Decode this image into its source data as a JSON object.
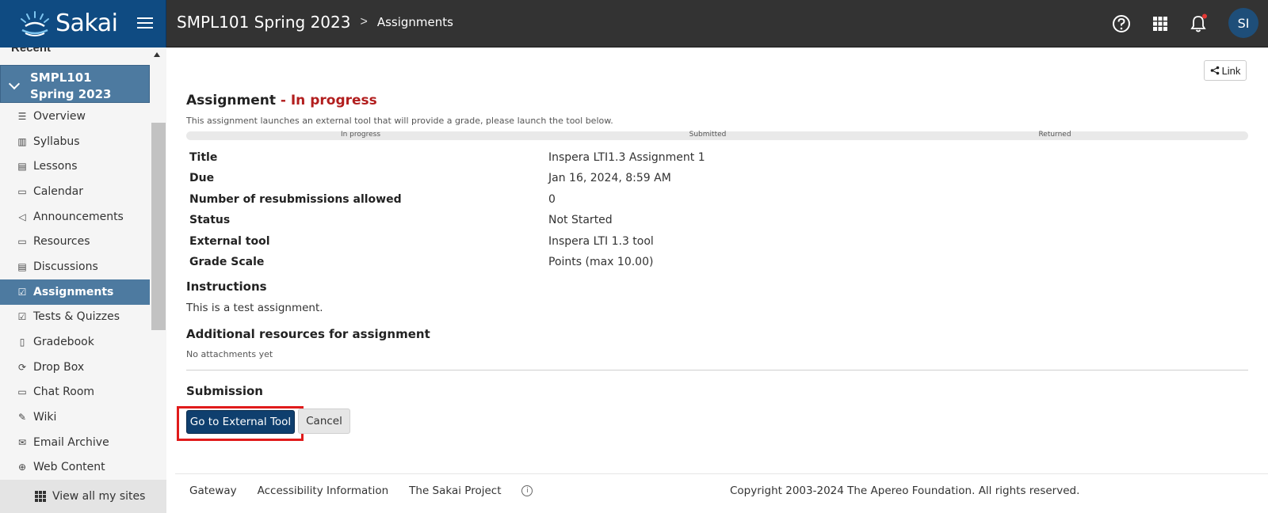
{
  "header": {
    "logo_text": "Sakai",
    "site_title": "SMPL101 Spring 2023",
    "breadcrumb_sep": ">",
    "tool_title": "Assignments",
    "avatar_initials": "SI"
  },
  "sidebar": {
    "recent_label": "Recent",
    "site_line1": "SMPL101",
    "site_line2": "Spring 2023",
    "items": [
      {
        "label": "Overview",
        "icon": "list-icon",
        "glyph": "☰"
      },
      {
        "label": "Syllabus",
        "icon": "map-icon",
        "glyph": "▥"
      },
      {
        "label": "Lessons",
        "icon": "document-icon",
        "glyph": "▤"
      },
      {
        "label": "Calendar",
        "icon": "calendar-icon",
        "glyph": "▭"
      },
      {
        "label": "Announcements",
        "icon": "megaphone-icon",
        "glyph": "◁"
      },
      {
        "label": "Resources",
        "icon": "folder-icon",
        "glyph": "▭"
      },
      {
        "label": "Discussions",
        "icon": "chat-icon",
        "glyph": "▤"
      },
      {
        "label": "Assignments",
        "icon": "assignment-icon",
        "glyph": "☑"
      },
      {
        "label": "Tests & Quizzes",
        "icon": "checkbox-icon",
        "glyph": "☑"
      },
      {
        "label": "Gradebook",
        "icon": "book-icon",
        "glyph": "▯"
      },
      {
        "label": "Drop Box",
        "icon": "sync-icon",
        "glyph": "⟳"
      },
      {
        "label": "Chat Room",
        "icon": "chat-room-icon",
        "glyph": "▭"
      },
      {
        "label": "Wiki",
        "icon": "edit-icon",
        "glyph": "✎"
      },
      {
        "label": "Email Archive",
        "icon": "mail-icon",
        "glyph": "✉"
      },
      {
        "label": "Web Content",
        "icon": "globe-icon",
        "glyph": "⊕"
      }
    ],
    "view_all": "View all my sites"
  },
  "main": {
    "link_label": "Link",
    "title_prefix": "Assignment",
    "title_state": " - In progress",
    "description": "This assignment launches an external tool that will provide a grade, please launch the tool below.",
    "progress_steps": [
      "In progress",
      "Submitted",
      "Returned"
    ],
    "details": [
      {
        "label": "Title",
        "value": "Inspera LTI1.3 Assignment 1"
      },
      {
        "label": "Due",
        "value": "Jan 16, 2024, 8:59 AM"
      },
      {
        "label": "Number of resubmissions allowed",
        "value": "0"
      },
      {
        "label": "Status",
        "value": "Not Started"
      },
      {
        "label": "External tool",
        "value": "Inspera LTI 1.3 tool"
      },
      {
        "label": "Grade Scale",
        "value": "Points (max 10.00)"
      }
    ],
    "instructions_heading": "Instructions",
    "instructions_text": "This is a test assignment.",
    "resources_heading": "Additional resources for assignment",
    "resources_text": "No attachments yet",
    "submission_heading": "Submission",
    "go_button": "Go to External Tool",
    "cancel_button": "Cancel"
  },
  "footer": {
    "links": [
      "Gateway",
      "Accessibility Information",
      "The Sakai Project"
    ],
    "copyright": "Copyright 2003-2024 The Apereo Foundation. All rights reserved."
  }
}
